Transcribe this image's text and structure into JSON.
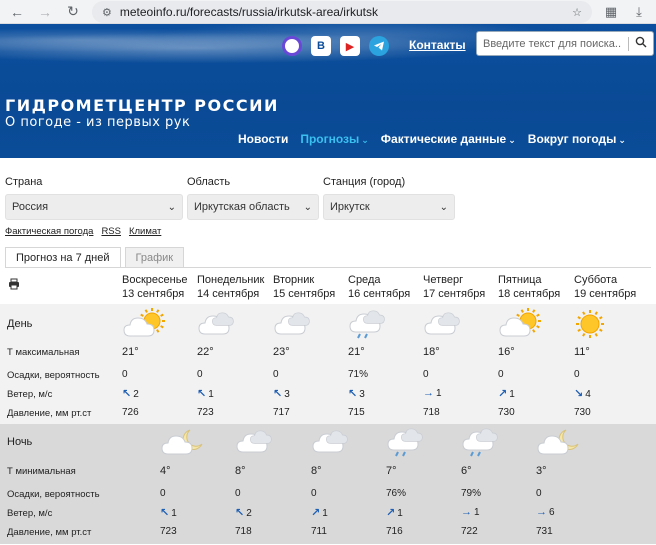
{
  "browser": {
    "url": "meteoinfo.ru/forecasts/russia/irkutsk-area/irkutsk"
  },
  "header": {
    "contacts_label": "Контакты",
    "search_placeholder": "Введите текст для поиска...",
    "site_title": "ГИДРОМЕТЦЕНТР РОССИИ",
    "site_subtitle": "О погоде - из первых рук",
    "nav": [
      {
        "label": "Новости",
        "active": false,
        "dropdown": false
      },
      {
        "label": "Прогнозы",
        "active": true,
        "dropdown": true
      },
      {
        "label": "Фактические данные",
        "active": false,
        "dropdown": true
      },
      {
        "label": "Вокруг погоды",
        "active": false,
        "dropdown": true
      }
    ]
  },
  "filters": {
    "country": {
      "label": "Страна",
      "value": "Россия"
    },
    "region": {
      "label": "Область",
      "value": "Иркутская область"
    },
    "station": {
      "label": "Станция (город)",
      "value": "Иркутск"
    }
  },
  "links": [
    "Фактическая погода",
    "RSS",
    "Климат"
  ],
  "tabs": [
    {
      "label": "Прогноз на 7 дней",
      "active": true
    },
    {
      "label": "График",
      "active": false
    }
  ],
  "days": [
    {
      "name": "Воскресенье",
      "date": "13 сентября"
    },
    {
      "name": "Понедельник",
      "date": "14 сентября"
    },
    {
      "name": "Вторник",
      "date": "15 сентября"
    },
    {
      "name": "Среда",
      "date": "16 сентября"
    },
    {
      "name": "Четверг",
      "date": "17 сентября"
    },
    {
      "name": "Пятница",
      "date": "18 сентября"
    },
    {
      "name": "Суббота",
      "date": "19 сентября"
    }
  ],
  "day_section": {
    "title": "День",
    "labels": {
      "temp": "Т максимальная",
      "precip": "Осадки, вероятность",
      "wind": "Ветер, м/с",
      "pressure": "Давление, мм рт.ст"
    },
    "icons": [
      "cloud-sun-icon",
      "cloud-icon",
      "cloud-icon",
      "cloud-rain-icon",
      "cloud-icon",
      "cloud-sun-icon",
      "sun-icon"
    ],
    "temp": [
      "21°",
      "22°",
      "23°",
      "21°",
      "18°",
      "16°",
      "11°"
    ],
    "precip": [
      "0",
      "0",
      "0",
      "71%",
      "0",
      "0",
      "0"
    ],
    "wind": [
      {
        "dir": "nw",
        "speed": "2"
      },
      {
        "dir": "nw",
        "speed": "1"
      },
      {
        "dir": "nw",
        "speed": "3"
      },
      {
        "dir": "nw",
        "speed": "3"
      },
      {
        "dir": "e",
        "speed": "1"
      },
      {
        "dir": "ne",
        "speed": "1"
      },
      {
        "dir": "se",
        "speed": "4"
      }
    ],
    "pressure": [
      "726",
      "723",
      "717",
      "715",
      "718",
      "730",
      "730"
    ]
  },
  "night_section": {
    "title": "Ночь",
    "labels": {
      "temp": "Т минимальная",
      "precip": "Осадки, вероятность",
      "wind": "Ветер, м/с",
      "pressure": "Давление, мм рт.ст"
    },
    "icons": [
      "cloud-moon-icon",
      "cloud-icon",
      "cloud-icon",
      "cloud-rain-icon",
      "cloud-rain-icon",
      "cloud-moon-icon"
    ],
    "temp": [
      "4°",
      "8°",
      "8°",
      "7°",
      "6°",
      "3°"
    ],
    "precip": [
      "0",
      "0",
      "0",
      "76%",
      "79%",
      "0"
    ],
    "wind": [
      {
        "dir": "nw",
        "speed": "1"
      },
      {
        "dir": "nw",
        "speed": "2"
      },
      {
        "dir": "ne",
        "speed": "1"
      },
      {
        "dir": "ne",
        "speed": "1"
      },
      {
        "dir": "e",
        "speed": "1"
      },
      {
        "dir": "e",
        "speed": "6"
      }
    ],
    "pressure": [
      "723",
      "718",
      "711",
      "716",
      "722",
      "731"
    ]
  },
  "colors": {
    "banner": "#0b4c98",
    "nav_active": "#39c0f0",
    "wind_arrow": "#1e5fb4",
    "day_panel": "#f2f2f2",
    "night_panel": "#d9d9d9"
  }
}
